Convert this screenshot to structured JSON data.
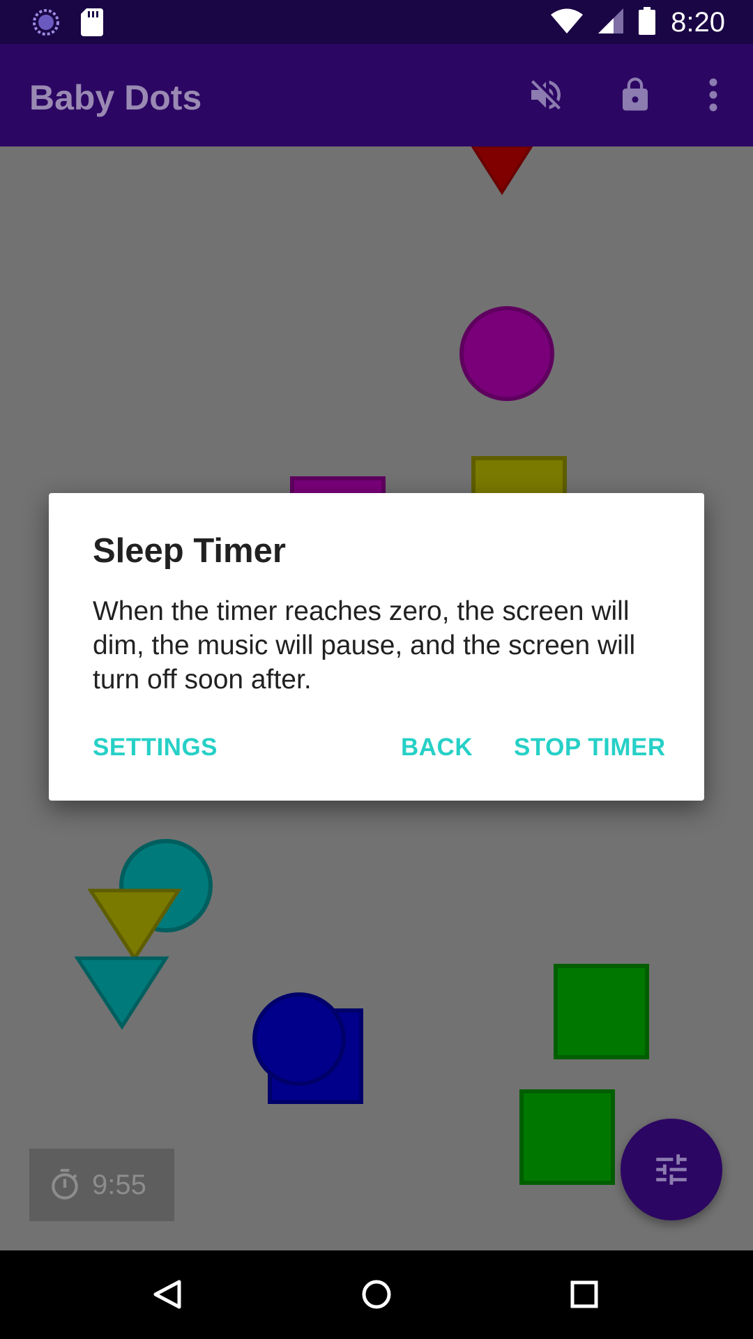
{
  "status_bar": {
    "time": "8:20",
    "icons": [
      "progress-icon",
      "sd-card-icon",
      "wifi-icon",
      "signal-icon",
      "battery-icon"
    ]
  },
  "app_bar": {
    "title": "Baby Dots",
    "actions": [
      "volume-off-icon",
      "lock-icon",
      "more-vert-icon"
    ]
  },
  "sleep_timer": {
    "remaining": "9:55",
    "icon": "timer-icon"
  },
  "fab": {
    "icon": "tune-icon",
    "color": "#2c0663"
  },
  "dialog": {
    "title": "Sleep Timer",
    "message": "When the timer reaches zero, the screen will dim, the music will pause, and the screen will turn off soon after.",
    "buttons": {
      "settings": "SETTINGS",
      "back": "BACK",
      "stop_timer": "STOP TIMER"
    },
    "accent_color": "#26d0c6"
  },
  "shapes": [
    {
      "type": "triangle",
      "color": "red"
    },
    {
      "type": "circle",
      "color": "purple"
    },
    {
      "type": "square",
      "color": "purple"
    },
    {
      "type": "square",
      "color": "olive"
    },
    {
      "type": "circle",
      "color": "teal"
    },
    {
      "type": "triangle",
      "color": "olive"
    },
    {
      "type": "triangle",
      "color": "teal"
    },
    {
      "type": "square",
      "color": "navy"
    },
    {
      "type": "circle",
      "color": "navy"
    },
    {
      "type": "square",
      "color": "green"
    },
    {
      "type": "square",
      "color": "green"
    }
  ],
  "nav_bar": {
    "buttons": [
      "back-icon",
      "home-icon",
      "recents-icon"
    ]
  }
}
